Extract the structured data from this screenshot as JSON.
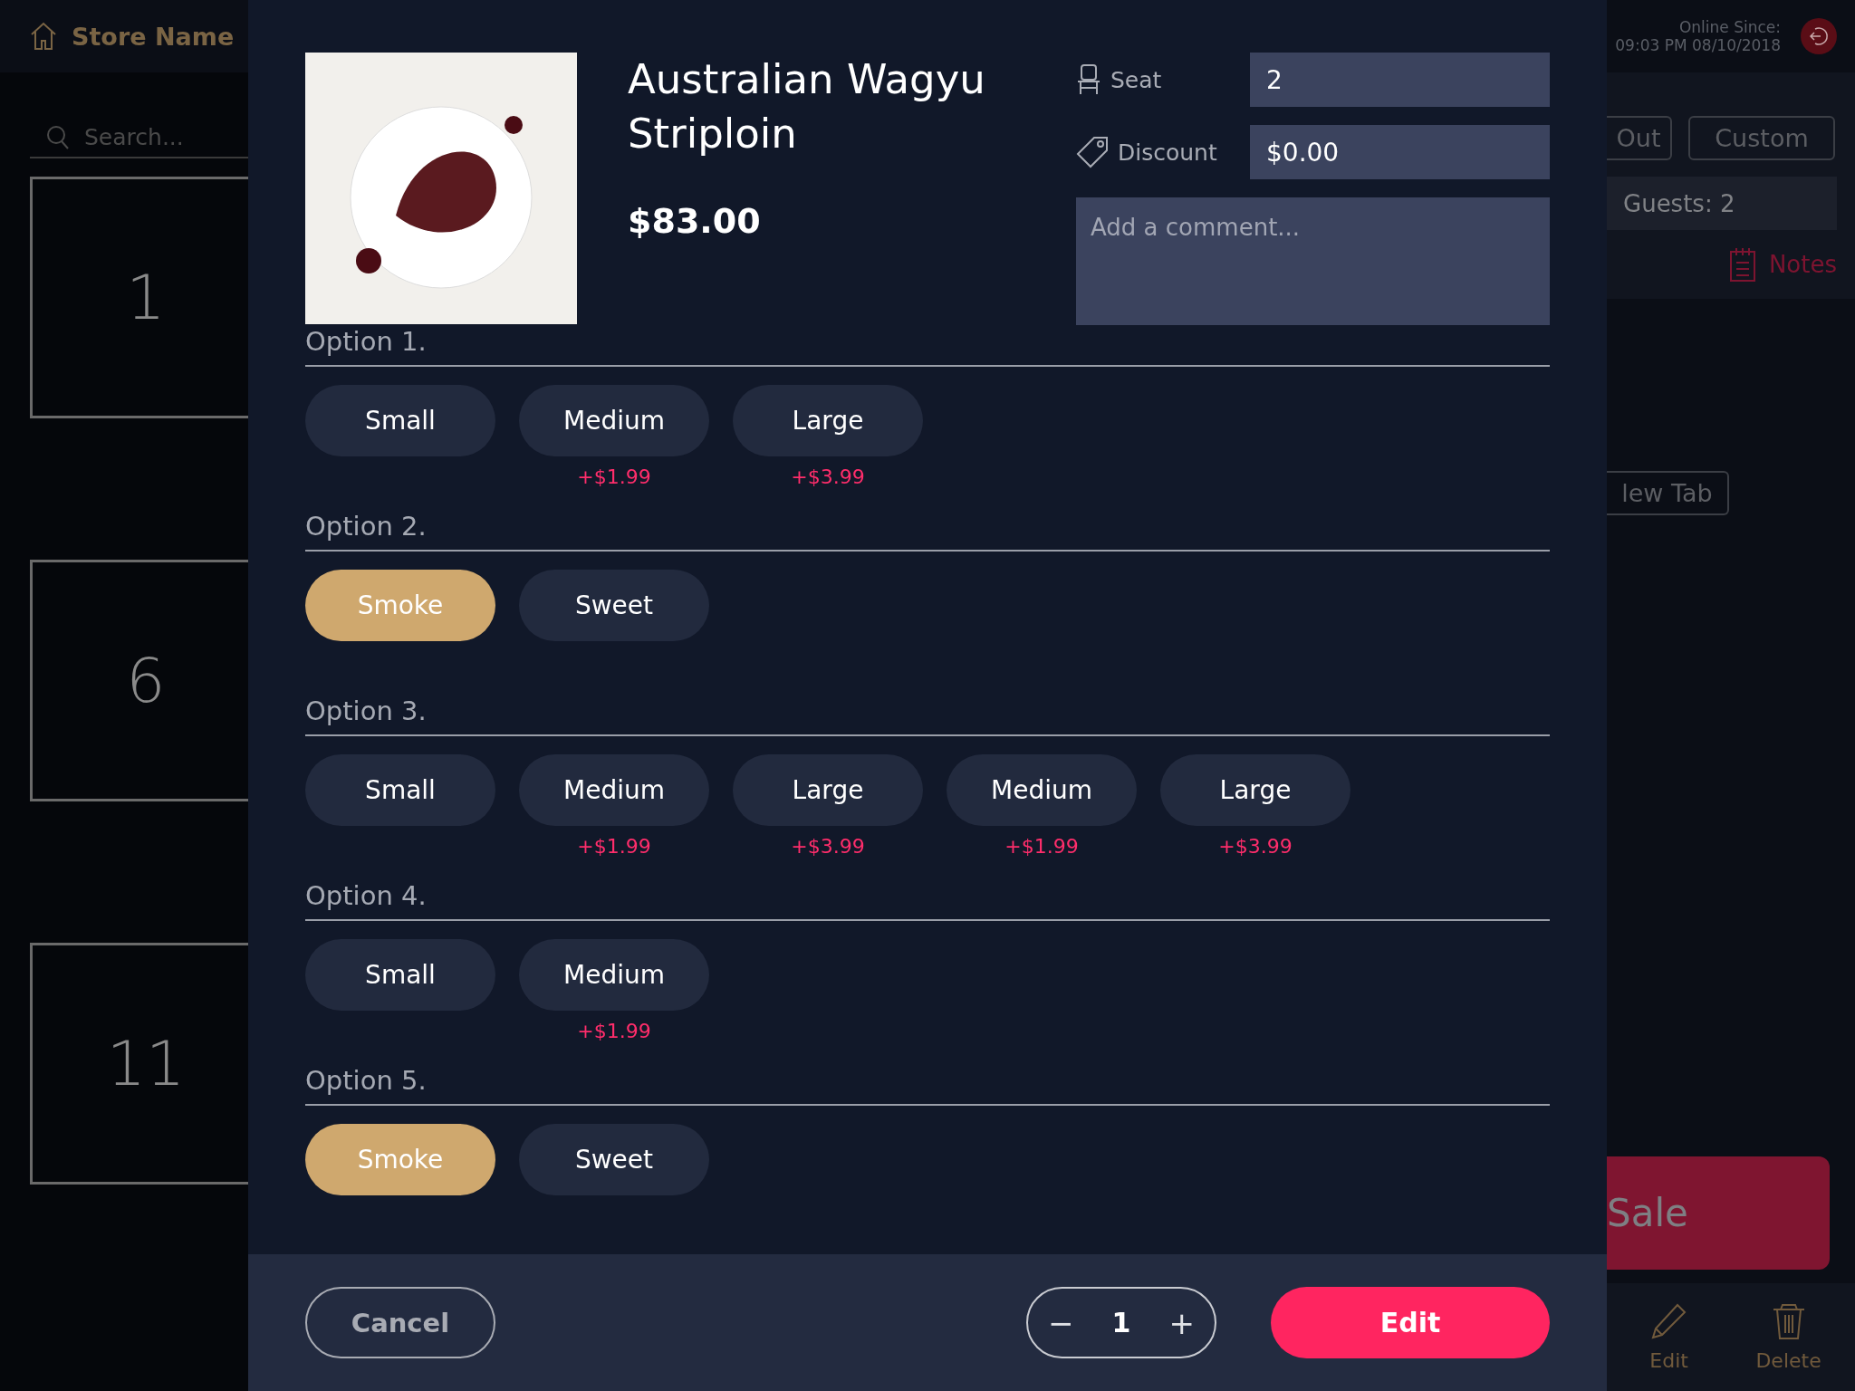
{
  "background": {
    "store_name": "Store Name",
    "search": {
      "placeholder": "Search..."
    },
    "tables": [
      "1",
      "6",
      "11"
    ],
    "online_label": "Online Since:",
    "online_time": "09:03 PM 08/10/2018",
    "order_buttons": [
      "Out",
      "Custom"
    ],
    "guests": "Guests: 2",
    "notes": "Notes",
    "new_tab": "lew Tab",
    "sale": "Sale",
    "actions": [
      "Edit",
      "Delete"
    ]
  },
  "item": {
    "name": "Australian Wagyu Striploin",
    "price": "$83.00"
  },
  "fields": [
    {
      "kind": "seat",
      "label": "Seat",
      "value": "2"
    },
    {
      "kind": "discount",
      "label": "Discount",
      "value": "$0.00"
    }
  ],
  "comment": {
    "placeholder": "Add a comment..."
  },
  "options": [
    {
      "label": "Option 1.",
      "choices": [
        {
          "label": "Small",
          "selected": false
        },
        {
          "label": "Medium",
          "price": "+$1.99",
          "selected": false
        },
        {
          "label": "Large",
          "price": "+$3.99",
          "selected": false
        }
      ]
    },
    {
      "label": "Option 2.",
      "choices": [
        {
          "label": "Smoke",
          "selected": true
        },
        {
          "label": "Sweet",
          "selected": false
        }
      ]
    },
    {
      "label": "Option 3.",
      "choices": [
        {
          "label": "Small",
          "selected": false
        },
        {
          "label": "Medium",
          "price": "+$1.99",
          "selected": false
        },
        {
          "label": "Large",
          "price": "+$3.99",
          "selected": false
        },
        {
          "label": "Medium",
          "price": "+$1.99",
          "selected": false
        },
        {
          "label": "Large",
          "price": "+$3.99",
          "selected": false
        }
      ]
    },
    {
      "label": "Option 4.",
      "choices": [
        {
          "label": "Small",
          "selected": false
        },
        {
          "label": "Medium",
          "price": "+$1.99",
          "selected": false
        }
      ]
    },
    {
      "label": "Option 5.",
      "choices": [
        {
          "label": "Smoke",
          "selected": true
        },
        {
          "label": "Sweet",
          "selected": false
        }
      ]
    }
  ],
  "footer": {
    "cancel": "Cancel",
    "quantity": "1",
    "minus": "−",
    "plus": "+",
    "confirm": "Edit"
  }
}
